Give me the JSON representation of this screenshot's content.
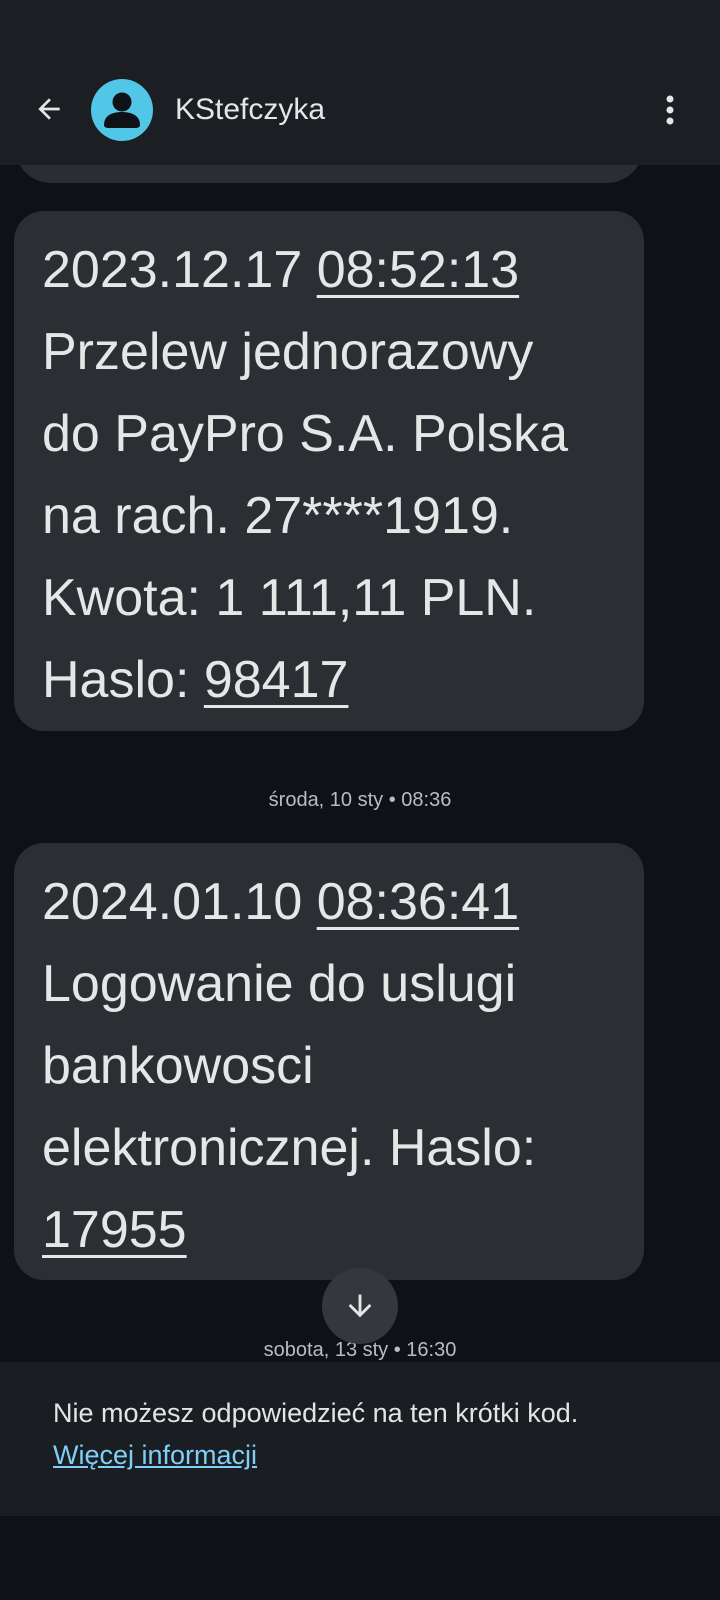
{
  "header": {
    "contact_name": "KStefczyka",
    "back_icon": "arrow-back-icon",
    "menu_icon": "more-vert-icon",
    "avatar_icon": "person-icon",
    "avatar_color": "#51c6e6"
  },
  "messages": [
    {
      "lines": [
        {
          "pre": "2023.12.17 ",
          "link": "08:52:13"
        },
        {
          "text": "Przelew jednorazowy"
        },
        {
          "text": "do PayPro S.A.  Polska"
        },
        {
          "text": "na rach. 27****1919."
        },
        {
          "text": "Kwota: 1 111,11 PLN."
        },
        {
          "pre": "Haslo: ",
          "link": "98417"
        }
      ]
    },
    {
      "lines": [
        {
          "pre": "2024.01.10 ",
          "link": "08:36:41"
        },
        {
          "text": "Logowanie do uslugi"
        },
        {
          "text": "bankowosci"
        },
        {
          "text": "elektronicznej. Haslo:"
        },
        {
          "link": "17955"
        }
      ]
    }
  ],
  "date_separators": [
    "środa, 10 sty • 08:36",
    "sobota, 13 sty • 16:30"
  ],
  "scroll_button_icon": "arrow-down-icon",
  "footer": {
    "notice": "Nie możesz odpowiedzieć na ten krótki kod.",
    "link": "Więcej informacji",
    "link_color": "#7fcff7"
  }
}
